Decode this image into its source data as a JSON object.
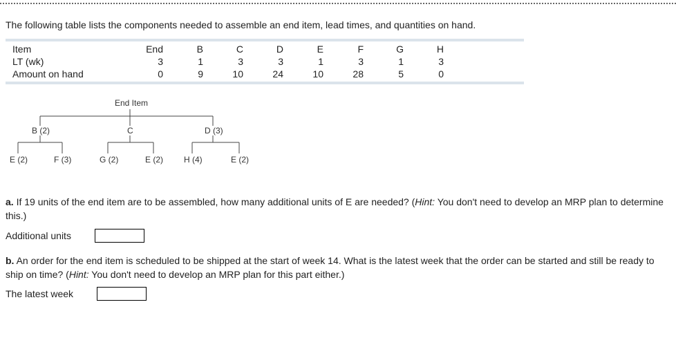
{
  "intro": "The following table lists the components needed to assemble an end item, lead times, and quantities on hand.",
  "table": {
    "row_labels": {
      "item": "Item",
      "lt": "LT (wk)",
      "amount": "Amount on hand"
    },
    "cols": [
      "End",
      "B",
      "C",
      "D",
      "E",
      "F",
      "G",
      "H"
    ],
    "lt": [
      "3",
      "1",
      "3",
      "3",
      "1",
      "3",
      "1",
      "3"
    ],
    "amt": [
      "0",
      "9",
      "10",
      "24",
      "10",
      "28",
      "5",
      "0"
    ]
  },
  "tree": {
    "root": "End Item",
    "b": "B (2)",
    "c": "C",
    "d": "D (3)",
    "e1": "E (2)",
    "f": "F (3)",
    "g": "G (2)",
    "e2": "E (2)",
    "h": "H (4)",
    "e3": "E (2)"
  },
  "qa": {
    "a_letter": "a.",
    "a_text": " If 19 units of the end item are to be assembled, how many additional units of E are needed? (",
    "a_hint_label": "Hint:",
    "a_hint_text": " You don't need to develop an MRP plan to determine this.)",
    "a_answer_label": "Additional units",
    "b_letter": "b.",
    "b_text": " An order for the end item is scheduled to be shipped at the start of week 14. What is the latest week that the order can be started and still be ready to ship on time? (",
    "b_hint_label": "Hint:",
    "b_hint_text": " You don't need to develop an MRP plan for this part either.)",
    "b_answer_label": "The latest week"
  }
}
